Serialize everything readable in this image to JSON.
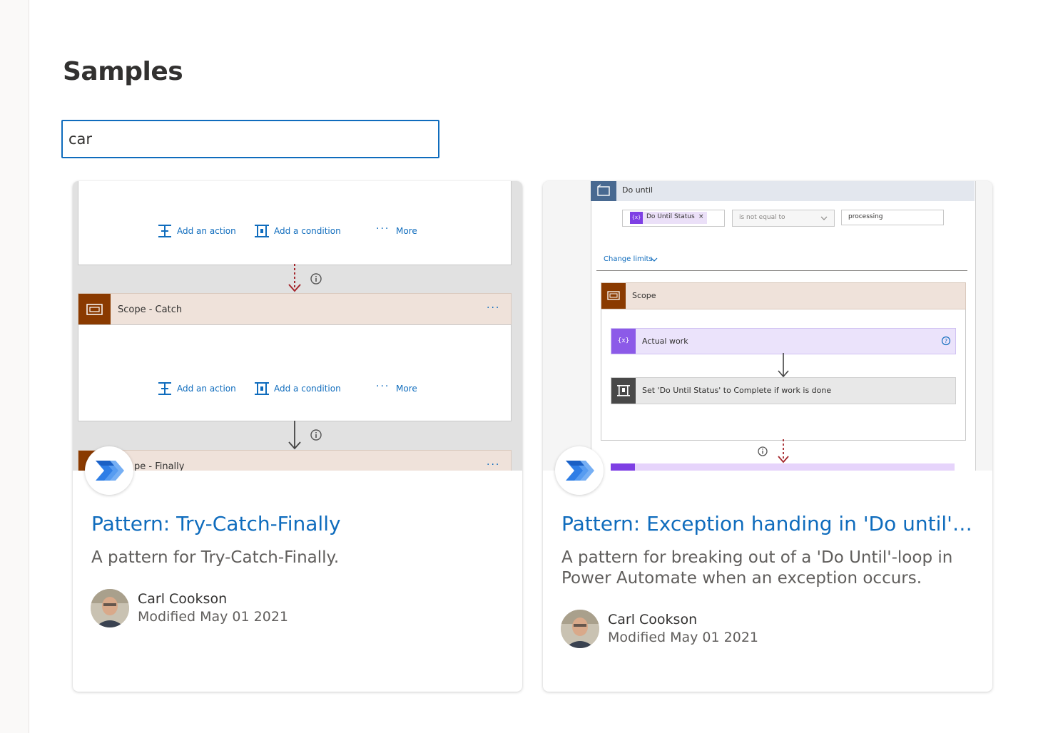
{
  "page": {
    "title": "Samples"
  },
  "search": {
    "value": "car"
  },
  "cards": [
    {
      "title": "Pattern: Try-Catch-Finally",
      "description": "A pattern for Try-Catch-Finally.",
      "author": "Carl Cookson",
      "modified": "Modified May 01 2021",
      "preview": {
        "add_action": "Add an action",
        "add_condition": "Add a condition",
        "more": "More",
        "scope_catch": "Scope - Catch",
        "scope_finally": "pe - Finally"
      }
    },
    {
      "title": "Pattern: Exception handing in 'Do until'-l...",
      "description": "A pattern for breaking out of a 'Do Until'-loop in Power Automate when an exception occurs.",
      "author": "Carl Cookson",
      "modified": "Modified May 01 2021",
      "preview": {
        "do_until": "Do until",
        "token": "Do Until Status",
        "operator": "is not equal to",
        "value": "processing",
        "change_limits": "Change limits",
        "scope": "Scope",
        "actual_work": "Actual work",
        "set_status": "Set 'Do Until Status' to Complete if work is done"
      }
    }
  ],
  "colors": {
    "accent": "#0f6cbd",
    "scope_brown": "#8a3a00",
    "variable_purple": "#7e3fe4",
    "arrow_red": "#a4262c"
  },
  "icons": [
    "power-automate-logo-icon",
    "add-action-icon",
    "add-condition-icon",
    "info-icon",
    "scope-icon",
    "variable-icon",
    "loop-icon",
    "help-icon",
    "condition-icon"
  ]
}
